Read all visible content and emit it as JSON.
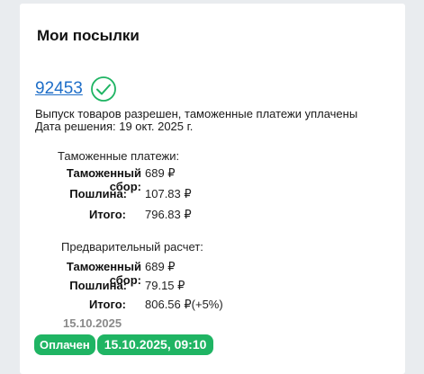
{
  "page": {
    "title": "Мои посылки"
  },
  "parcel": {
    "number": "92453",
    "status_text": "Выпуск товаров разрешен, таможенные платежи уплачены",
    "decision_date": "Дата решения: 19 окт. 2025 г."
  },
  "customs": {
    "title": "Таможенные платежи:",
    "rows": [
      {
        "label": "Таможенный сбор:",
        "value": "689 ₽"
      },
      {
        "label": "Пошлина:",
        "value": "107.83 ₽"
      },
      {
        "label": "Итого:",
        "value": "796.83 ₽"
      }
    ]
  },
  "estimate": {
    "title": "Предварительный расчет:",
    "rows": [
      {
        "label": "Таможенный сбор:",
        "value": "689 ₽"
      },
      {
        "label": "Пошлина:",
        "value": "79.15 ₽"
      },
      {
        "label": "Итого:",
        "value": "806.56 ₽(+5%)"
      }
    ],
    "date": "15.10.2025"
  },
  "payment": {
    "status_badge": "Оплачен",
    "date_badge": "15.10.2025, 09:10"
  },
  "colors": {
    "accent": "#1fb463",
    "link": "#1e6ec8"
  },
  "icons": {
    "parcel_status": "check-circle-icon"
  }
}
